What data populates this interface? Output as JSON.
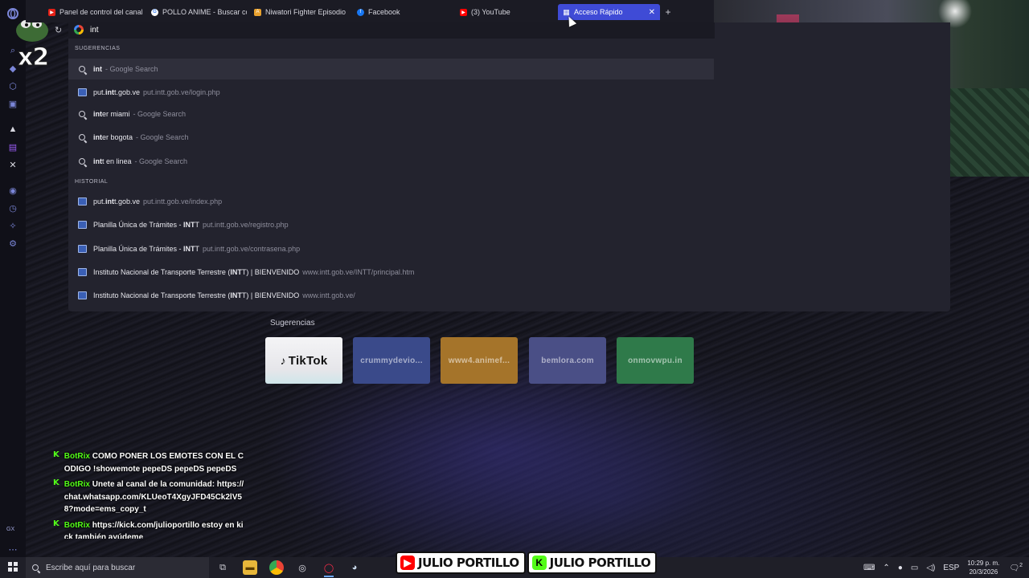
{
  "tabs": [
    {
      "title": "Panel de control del canal",
      "icon": "youtube-studio-icon",
      "color": "#e62117"
    },
    {
      "title": "POLLO ANIME - Buscar co",
      "icon": "google-icon",
      "color": "#4285f4"
    },
    {
      "title": "Niwatori Fighter Episodio",
      "icon": "animeflv-icon",
      "color": "#e8a12e"
    },
    {
      "title": "Facebook",
      "icon": "facebook-icon",
      "color": "#1877f2"
    },
    {
      "title": "(3) YouTube",
      "icon": "youtube-icon",
      "color": "#ff0000"
    },
    {
      "title": "Acceso Rápido",
      "icon": "speed-dial-icon",
      "color": "#3f4bd6"
    }
  ],
  "address_bar": {
    "value": "int"
  },
  "suggestions_label": "SUGERENCIAS",
  "suggestions": [
    {
      "match": "int",
      "rest": "",
      "sub": "- Google Search",
      "icon": "search-icon"
    },
    {
      "match": "put.",
      "bold": "int",
      "rest": "t.gob.ve",
      "sub": "put.intt.gob.ve/login.php",
      "icon": "site-icon"
    },
    {
      "match": "int",
      "rest": "er miami",
      "sub": "- Google Search",
      "icon": "search-icon"
    },
    {
      "match": "int",
      "rest": "er bogota",
      "sub": "- Google Search",
      "icon": "search-icon"
    },
    {
      "match": "int",
      "rest": "t en linea",
      "sub": "- Google Search",
      "icon": "search-icon"
    }
  ],
  "history_label": "HISTORIAL",
  "history": [
    {
      "pre": "put.",
      "bold": "int",
      "rest": "t.gob.ve",
      "sub": "put.intt.gob.ve/index.php"
    },
    {
      "pre": "Planilla Única de Trámites - ",
      "bold": "INT",
      "rest": "T",
      "sub": "put.intt.gob.ve/registro.php"
    },
    {
      "pre": "Planilla Única de Trámites - ",
      "bold": "INT",
      "rest": "T",
      "sub": "put.intt.gob.ve/contrasena.php"
    },
    {
      "pre": "Instituto Nacional de Transporte Terrestre (",
      "bold": "INT",
      "rest": "T) | BIENVENIDO",
      "sub": "www.intt.gob.ve/INTT/principal.htm"
    },
    {
      "pre": "Instituto Nacional de Transporte Terrestre (",
      "bold": "INT",
      "rest": "T) | BIENVENIDO",
      "sub": "www.intt.gob.ve/"
    }
  ],
  "speed_dial": {
    "label": "Sugerencias",
    "tiles": [
      {
        "label": "TikTok",
        "color": "#eeeef2"
      },
      {
        "label": "crummydevio...",
        "color": "#3a4a8a"
      },
      {
        "label": "www4.animef...",
        "color": "#a5742a"
      },
      {
        "label": "bemlora.com",
        "color": "#4a4f86"
      },
      {
        "label": "onmovwpu.in",
        "color": "#2f7a4a"
      }
    ]
  },
  "overlay": {
    "multiplier": "x2"
  },
  "chat": [
    {
      "user": "BotRix",
      "text": "COMO PONER LOS EMOTES CON EL CODIGO !showemote pepeDS pepeDS pepeDS"
    },
    {
      "user": "BotRix",
      "text": "Unete al canal de la comunidad: https://chat.whatsapp.com/KLUeoT4XgyJFD45Ck2lV58?mode=ems_copy_t"
    },
    {
      "user": "BotRix",
      "text": "https://kick.com/julioportillo estoy en kick también ayúdeme"
    }
  ],
  "taskbar": {
    "search_placeholder": "Escribe aquí para buscar",
    "brand_name_1": "JULIO PORTILLO",
    "brand_name_2": "JULIO PORTILLO",
    "lang": "ESP",
    "time": "10:29 p. m.",
    "date": "20/3/2026",
    "notifications": "2"
  },
  "colors": {
    "accent": "#3f4bd6",
    "kick_green": "#53fc18",
    "youtube_red": "#ff0000"
  }
}
